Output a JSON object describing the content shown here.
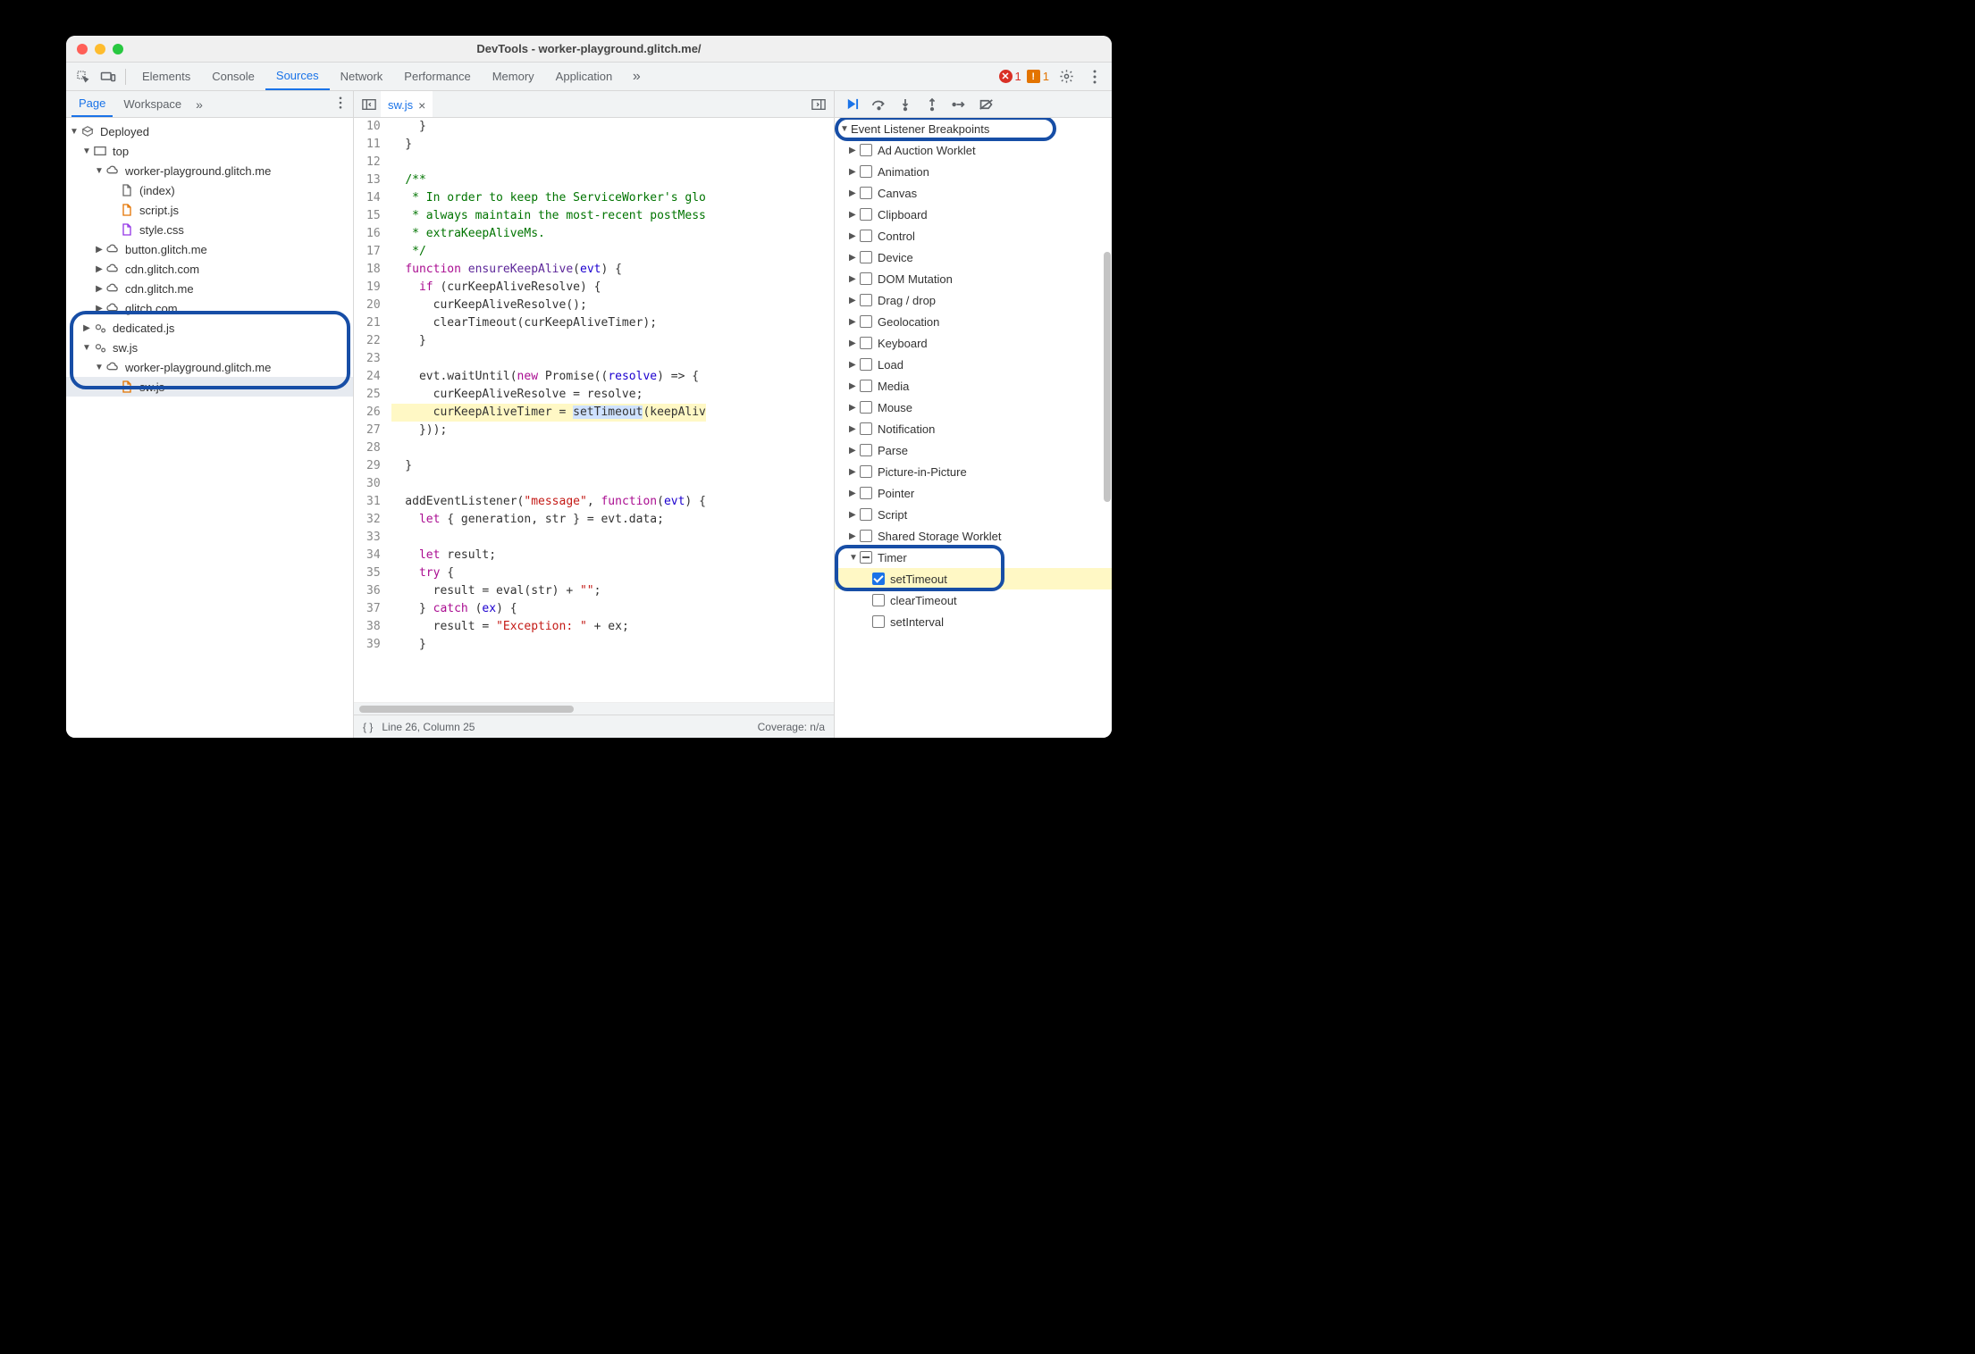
{
  "window_title": "DevTools - worker-playground.glitch.me/",
  "errors": "1",
  "warnings": "1",
  "main_tabs": [
    "Elements",
    "Console",
    "Sources",
    "Network",
    "Performance",
    "Memory",
    "Application"
  ],
  "main_active": "Sources",
  "left_tabs": [
    "Page",
    "Workspace"
  ],
  "left_active": "Page",
  "tree": {
    "root": "Deployed",
    "top": "top",
    "origin1": "worker-playground.glitch.me",
    "files1": [
      "(index)",
      "script.js",
      "style.css"
    ],
    "origins_collapsed": [
      "button.glitch.me",
      "cdn.glitch.com",
      "cdn.glitch.me",
      "glitch.com"
    ],
    "dedicated": "dedicated.js",
    "sw_root": "sw.js",
    "sw_origin": "worker-playground.glitch.me",
    "sw_file": "sw.js"
  },
  "editor": {
    "open_tab": "sw.js",
    "first_line": 10,
    "last_line": 39,
    "paused_line": 26,
    "status_text": "Line 26, Column 25",
    "coverage": "Coverage: n/a"
  },
  "code_lines": [
    {
      "n": 10,
      "html": "    }"
    },
    {
      "n": 11,
      "html": "  }"
    },
    {
      "n": 12,
      "html": ""
    },
    {
      "n": 13,
      "html": "  <span class='cmt'>/**</span>"
    },
    {
      "n": 14,
      "html": "  <span class='cmt'> * In order to keep the ServiceWorker's glo</span>"
    },
    {
      "n": 15,
      "html": "  <span class='cmt'> * always maintain the most-recent postMess</span>"
    },
    {
      "n": 16,
      "html": "  <span class='cmt'> * extraKeepAliveMs.</span>"
    },
    {
      "n": 17,
      "html": "  <span class='cmt'> */</span>"
    },
    {
      "n": 18,
      "html": "  <span class='kw'>function</span> <span class='fn'>ensureKeepAlive</span>(<span class='ident'>evt</span>) {"
    },
    {
      "n": 19,
      "html": "    <span class='kw'>if</span> (curKeepAliveResolve) {"
    },
    {
      "n": 20,
      "html": "      curKeepAliveResolve();"
    },
    {
      "n": 21,
      "html": "      clearTimeout(curKeepAliveTimer);"
    },
    {
      "n": 22,
      "html": "    }"
    },
    {
      "n": 23,
      "html": ""
    },
    {
      "n": 24,
      "html": "    evt.waitUntil(<span class='kw'>new</span> Promise((<span class='ident'>resolve</span>) =&gt; {"
    },
    {
      "n": 25,
      "html": "      curKeepAliveResolve = resolve;"
    },
    {
      "n": 26,
      "html": "      curKeepAliveTimer = <span class='hl-chars'>setTimeout</span>(keepAliv",
      "paused": true
    },
    {
      "n": 27,
      "html": "    }));"
    },
    {
      "n": 28,
      "html": ""
    },
    {
      "n": 29,
      "html": "  }"
    },
    {
      "n": 30,
      "html": ""
    },
    {
      "n": 31,
      "html": "  addEventListener(<span class='str'>\"message\"</span>, <span class='kw'>function</span>(<span class='ident'>evt</span>) {"
    },
    {
      "n": 32,
      "html": "    <span class='kw'>let</span> { generation, str } = evt.data;"
    },
    {
      "n": 33,
      "html": ""
    },
    {
      "n": 34,
      "html": "    <span class='kw'>let</span> result;"
    },
    {
      "n": 35,
      "html": "    <span class='kw'>try</span> {"
    },
    {
      "n": 36,
      "html": "      result = eval(str) + <span class='str'>\"\"</span>;"
    },
    {
      "n": 37,
      "html": "    } <span class='kw'>catch</span> (<span class='ident'>ex</span>) {"
    },
    {
      "n": 38,
      "html": "      result = <span class='str'>\"Exception: \"</span> + ex;"
    },
    {
      "n": 39,
      "html": "    }"
    }
  ],
  "breakpoints_header": "Event Listener Breakpoints",
  "categories": [
    "Ad Auction Worklet",
    "Animation",
    "Canvas",
    "Clipboard",
    "Control",
    "Device",
    "DOM Mutation",
    "Drag / drop",
    "Geolocation",
    "Keyboard",
    "Load",
    "Media",
    "Mouse",
    "Notification",
    "Parse",
    "Picture-in-Picture",
    "Pointer",
    "Script",
    "Shared Storage Worklet"
  ],
  "timer_cat": "Timer",
  "timer_children": [
    {
      "name": "setTimeout",
      "checked": true
    },
    {
      "name": "clearTimeout",
      "checked": false
    },
    {
      "name": "setInterval",
      "checked": false
    }
  ]
}
